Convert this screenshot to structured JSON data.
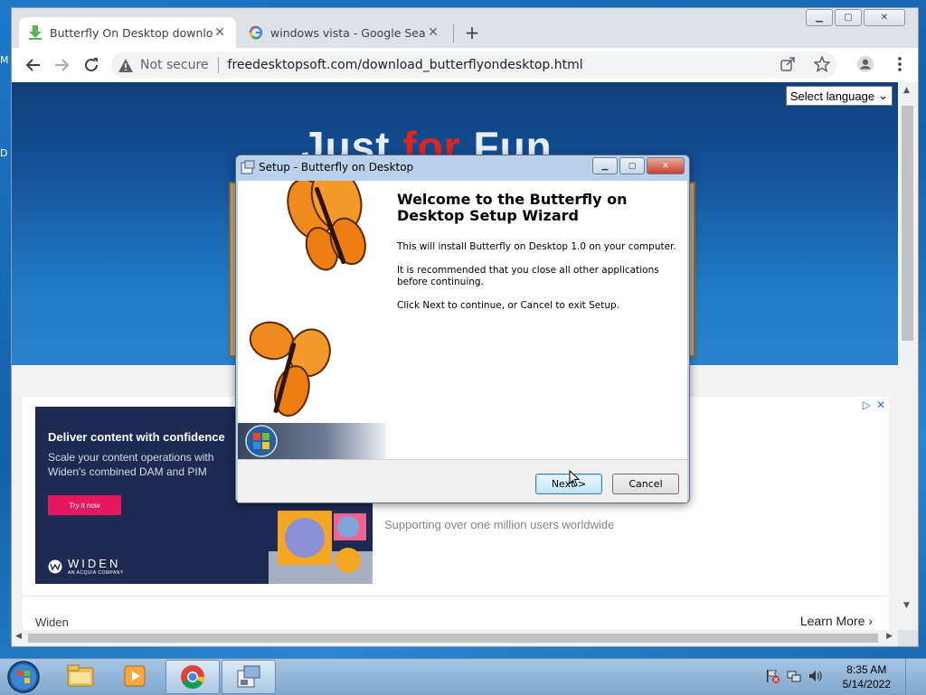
{
  "desktop": {
    "edge_letters": [
      "M",
      "D"
    ]
  },
  "browser": {
    "tabs": [
      {
        "title": "Butterfly On Desktop download |",
        "active": true
      },
      {
        "title": "windows vista - Google Search",
        "active": false
      }
    ],
    "new_tab": "+",
    "omnibox": {
      "security": "Not secure",
      "url": "freedesktopsoft.com/download_butterflyondesktop.html"
    },
    "window_controls": [
      "minimize",
      "maximize",
      "close"
    ]
  },
  "page": {
    "hero_title_a": "Just ",
    "hero_title_b": "for",
    "hero_title_c": " Fun",
    "language_select": "Select language",
    "ad": {
      "headline": "Deliver content with confidence",
      "subtext": "Scale your content operations with Widen's combined DAM and PIM",
      "cta": "Try it now",
      "brand": "WIDEN",
      "brand_sub": "AN ACQUIA COMPANY",
      "tagline": "Supporting over one million users worldwide",
      "advertiser": "Widen",
      "learn_more": "Learn More"
    }
  },
  "dialog": {
    "title": "Setup - Butterfly on Desktop",
    "heading": "Welcome to the Butterfly on Desktop Setup Wizard",
    "p1": "This will install Butterfly on Desktop 1.0 on your computer.",
    "p2": "It is recommended that you close all other applications before continuing.",
    "p3": "Click Next to continue, or Cancel to exit Setup.",
    "next": "Next >",
    "cancel": "Cancel"
  },
  "taskbar": {
    "time": "8:35 AM",
    "date": "5/14/2022"
  }
}
